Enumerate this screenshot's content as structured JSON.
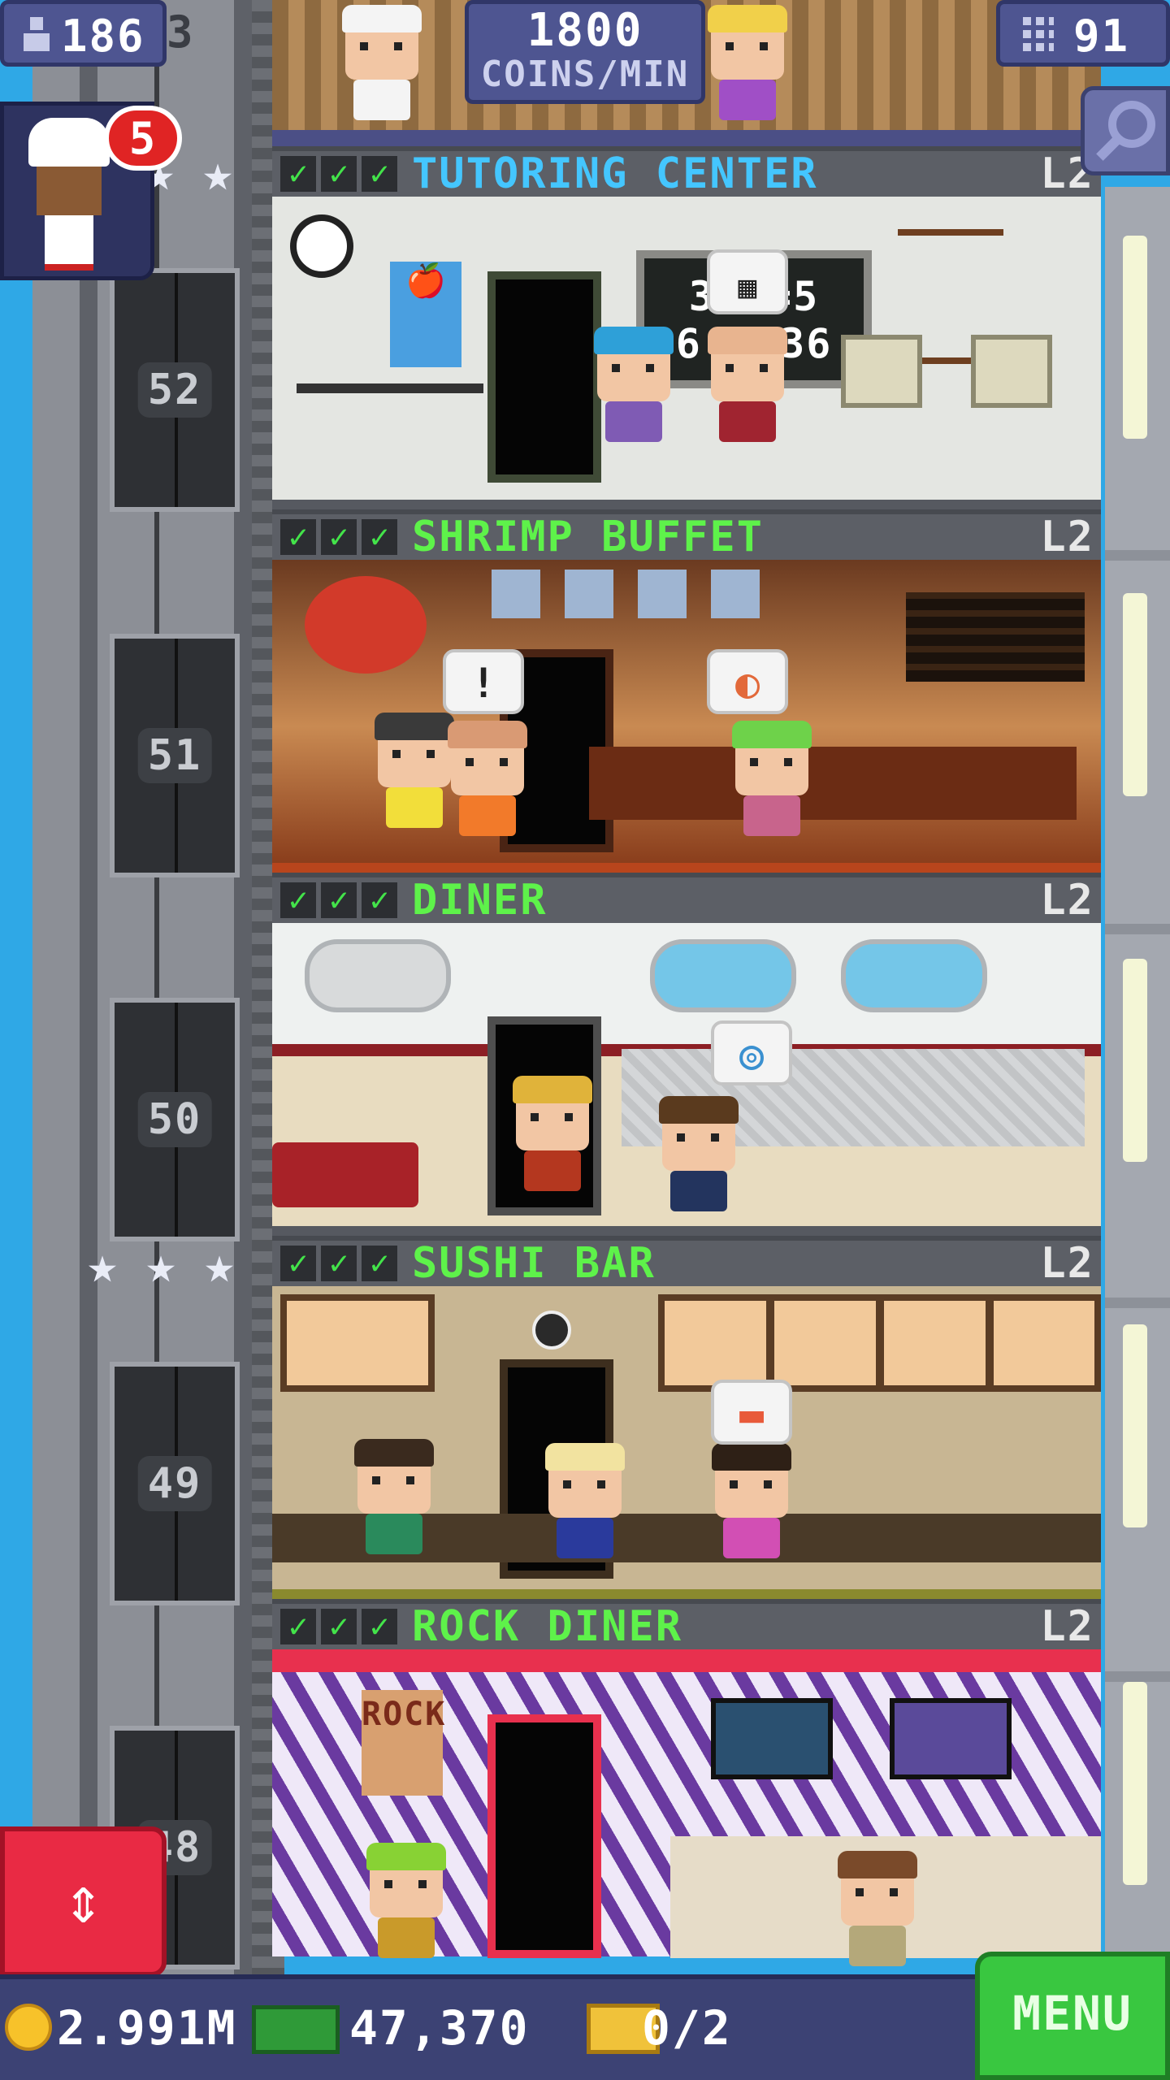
{
  "hud": {
    "population": "186",
    "coins_per_min_value": "1800",
    "coins_per_min_label": "COINS/MIN",
    "floors": "91",
    "chef_badge_count": "5",
    "hidden_label_fragment": "3"
  },
  "elevator": {
    "floor_numbers": [
      "52",
      "51",
      "50",
      "49",
      "48"
    ]
  },
  "floors": [
    {
      "name": "TUTORING CENTER",
      "level": "L2",
      "bubble": "",
      "chalkboard_line1": "3+2=5",
      "chalkboard_line2": "6   36"
    },
    {
      "name": "SHRIMP BUFFET",
      "level": "L2",
      "bubble": "!"
    },
    {
      "name": "DINER",
      "level": "L2"
    },
    {
      "name": "SUSHI BAR",
      "level": "L2"
    },
    {
      "name": "ROCK DINER",
      "level": "L2",
      "sign": "ROCK"
    }
  ],
  "bottom": {
    "coins": "2.991M",
    "bux": "47,370",
    "tickets": "0/2",
    "menu_label": "MENU"
  },
  "colors": {
    "header_green": "#5ef24a",
    "header_blue": "#44c6ff",
    "menu_green": "#39c740",
    "hud_purple": "#4e5591"
  }
}
